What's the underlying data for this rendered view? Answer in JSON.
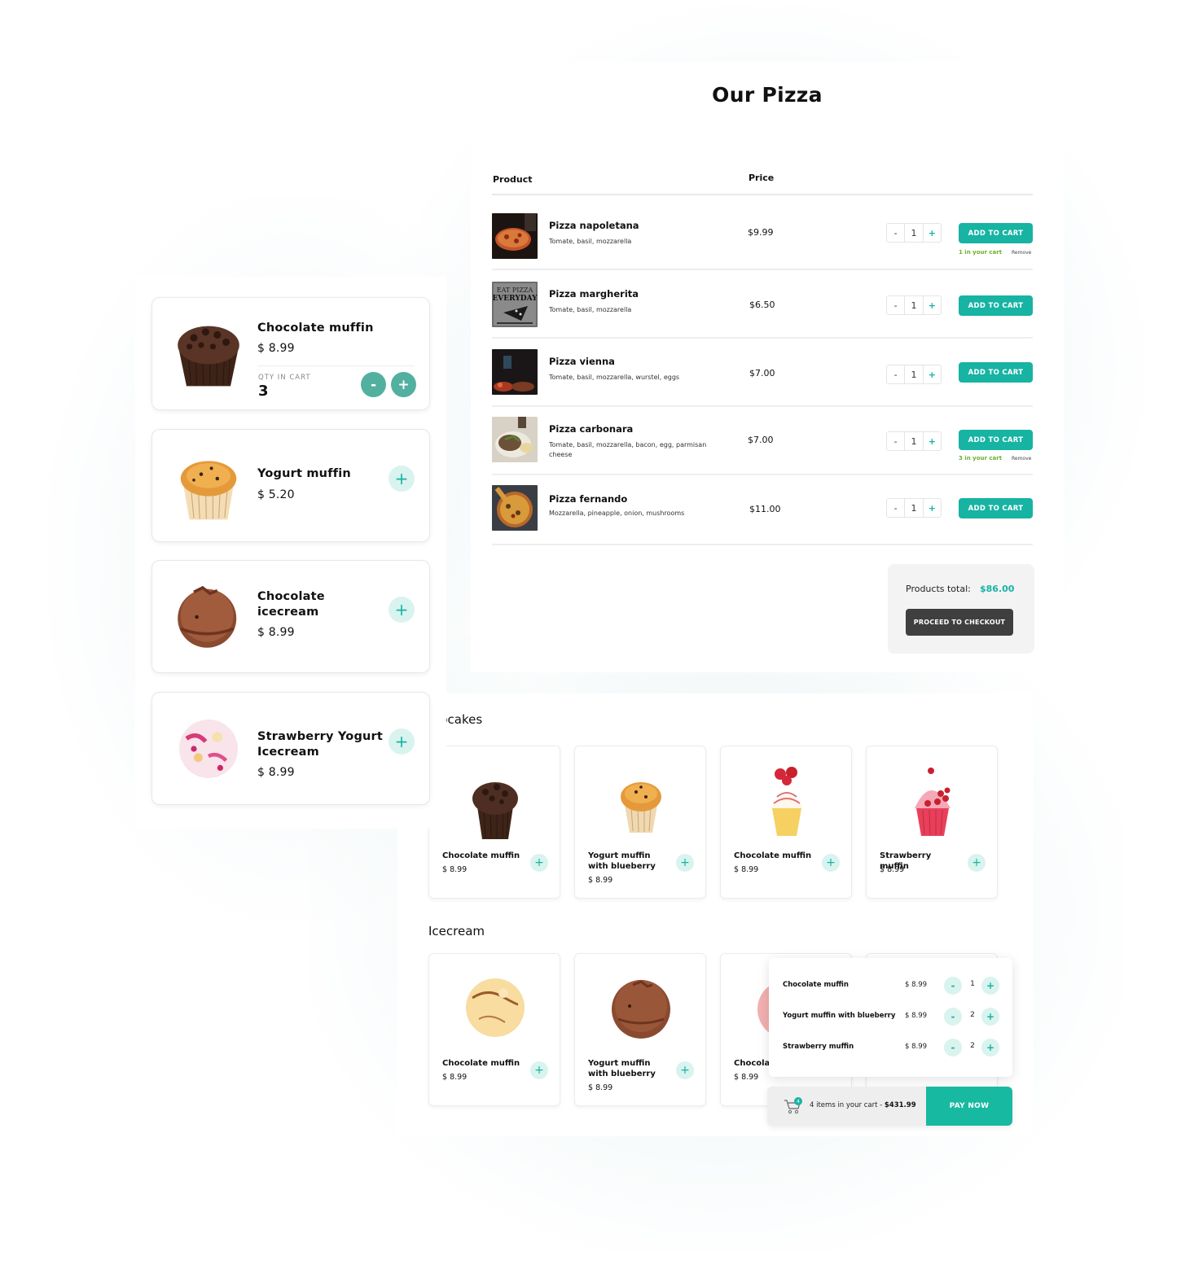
{
  "colors": {
    "accent": "#17b3a3",
    "in_cart_green": "#6cb12a",
    "checkout_dark": "#3f3f3f",
    "round_button": "#53b0a0",
    "soft_accent_bg": "#d9f3ef"
  },
  "pizza": {
    "title": "Our Pizza",
    "columns": {
      "product": "Product",
      "price": "Price"
    },
    "rows": [
      {
        "name": "Pizza napoletana",
        "desc": "Tomate, basil, mozzarella",
        "price": "$9.99",
        "qty": "1",
        "add_label": "ADD TO CART",
        "in_cart": "1 in your cart",
        "remove": "Remove",
        "thumb": "pizza-napoletana-photo"
      },
      {
        "name": "Pizza margherita",
        "desc": "Tomate, basil, mozzarella",
        "price": "$6.50",
        "qty": "1",
        "add_label": "ADD TO CART",
        "thumb": "eat-pizza-everyday-sign-photo"
      },
      {
        "name": "Pizza vienna",
        "desc": "Tomate, basil, mozzarella, wurstel, eggs",
        "price": "$7.00",
        "qty": "1",
        "add_label": "ADD TO CART",
        "thumb": "pizza-oven-photo"
      },
      {
        "name": "Pizza carbonara",
        "desc": "Tomate, basil, mozzarella, bacon, egg, parmisan cheese",
        "price": "$7.00",
        "qty": "1",
        "add_label": "ADD TO CART",
        "in_cart": "3 in your cart",
        "remove": "Remove",
        "thumb": "carbonara-plate-photo"
      },
      {
        "name": "Pizza fernando",
        "desc": "Mozzarella, pineapple, onion, mushrooms",
        "price": "$11.00",
        "qty": "1",
        "add_label": "ADD TO CART",
        "thumb": "pizza-fernando-photo"
      }
    ],
    "stepper": {
      "minus": "-",
      "plus": "+"
    },
    "total_label": "Products total:",
    "total_value": "$86.00",
    "checkout_label": "PROCEED TO CHECKOUT"
  },
  "mobile": {
    "items": [
      {
        "name": "Chocolate muffin",
        "price": "$ 8.99",
        "qty_label": "QTY IN CART",
        "qty": "3",
        "minus": "-",
        "plus": "+"
      },
      {
        "name": "Yogurt muffin",
        "price": "$ 5.20",
        "plus": "+"
      },
      {
        "name": "Chocolate icecream",
        "price": "$ 8.99",
        "plus": "+"
      },
      {
        "name": "Strawberry Yogurt Icecream",
        "price": "$ 8.99",
        "plus": "+"
      }
    ]
  },
  "catalog": {
    "cupcakes_heading": "pcakes",
    "cupcakes": [
      {
        "name": "Chocolate muffin",
        "price": "$ 8.99",
        "plus": "+"
      },
      {
        "name": "Yogurt muffin with blueberry",
        "price": "$ 8.99",
        "plus": "+"
      },
      {
        "name": "Chocolate muffin",
        "price": "$ 8.99",
        "plus": "+"
      },
      {
        "name": "Strawberry muffin",
        "price": "$ 8.99",
        "plus": "+"
      }
    ],
    "icecream_heading": "Icecream",
    "icecream": [
      {
        "name": "Chocolate muffin",
        "price": "$ 8.99",
        "plus": "+"
      },
      {
        "name": "Yogurt muffin with blueberry",
        "price": "$ 8.99",
        "plus": "+"
      },
      {
        "name": "Chocolat",
        "price": "$ 8.99"
      }
    ]
  },
  "cart": {
    "items": [
      {
        "name": "Chocolate muffin",
        "price": "$ 8.99",
        "qty": "1",
        "minus": "-",
        "plus": "+"
      },
      {
        "name": "Yogurt muffin with blueberry",
        "price": "$ 8.99",
        "qty": "2",
        "minus": "-",
        "plus": "+"
      },
      {
        "name": "Strawberry muffin",
        "price": "$ 8.99",
        "qty": "2",
        "minus": "-",
        "plus": "+"
      }
    ],
    "badge_count": "4",
    "summary_prefix": "4 items in your cart - ",
    "summary_total": "$431.99",
    "pay_label": "PAY NOW"
  }
}
